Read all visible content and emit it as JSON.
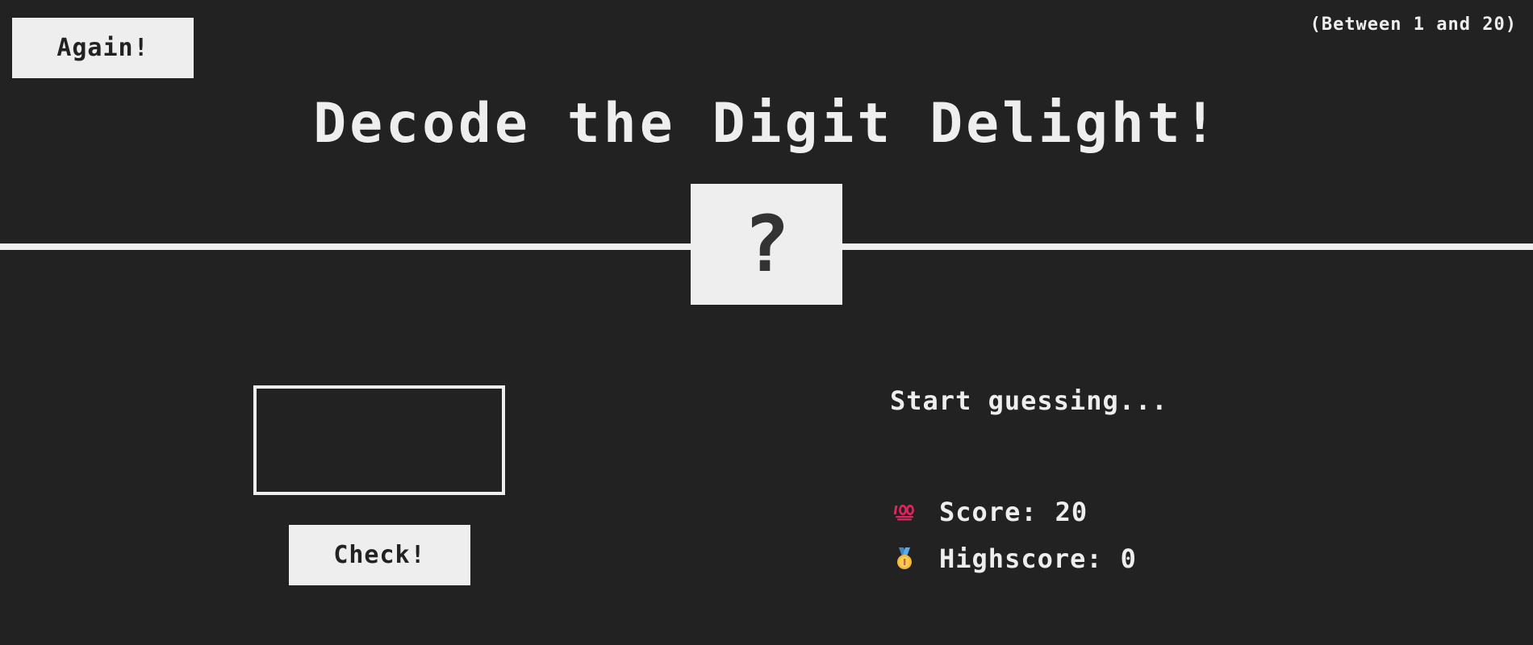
{
  "header": {
    "again_label": "Again!",
    "range_hint": "(Between 1 and 20)",
    "title": "Decode the Digit Delight!"
  },
  "secret": {
    "display": "?"
  },
  "guess": {
    "value": "",
    "check_label": "Check!"
  },
  "status": {
    "message": "Start guessing...",
    "score_label": "Score:",
    "score_value": "20",
    "highscore_label": "Highscore:",
    "highscore_value": "0",
    "score_icon": "hundred-points-icon",
    "highscore_icon": "medal-icon"
  },
  "colors": {
    "background": "#222222",
    "foreground": "#eeeeee",
    "score_icon": "#e0245e",
    "medal_gold": "#f4b63f",
    "medal_ribbon": "#3b88c3"
  }
}
